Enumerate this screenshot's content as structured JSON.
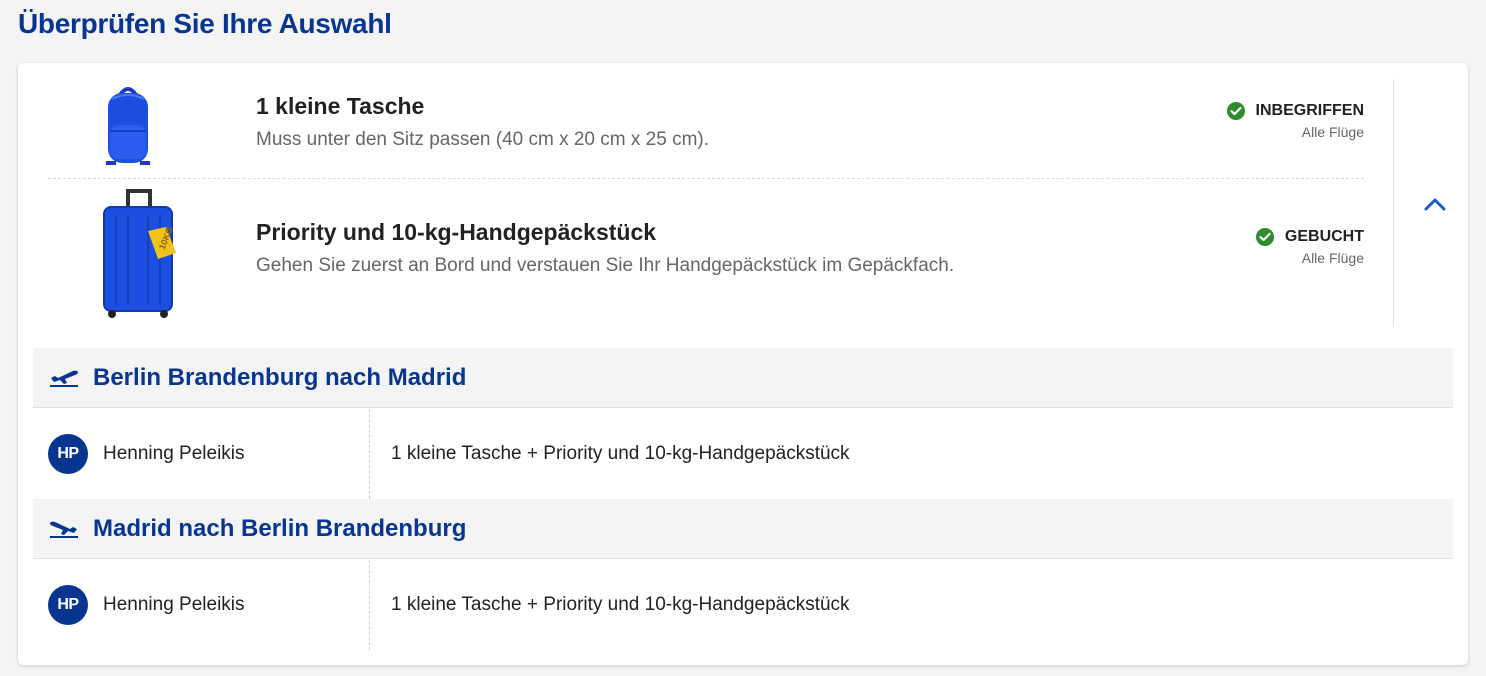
{
  "page_title": "Überprüfen Sie Ihre Auswahl",
  "bags": [
    {
      "icon": "backpack-icon",
      "title": "1 kleine Tasche",
      "description": "Muss unter den Sitz passen (40 cm x 20 cm x 25 cm).",
      "status": "INBEGRIFFEN",
      "status_sub": "Alle Flüge"
    },
    {
      "icon": "suitcase-icon",
      "tag_label": "10KG",
      "title": "Priority und 10-kg-Handgepäckstück",
      "description": "Gehen Sie zuerst an Bord und verstauen Sie Ihr Handgepäckstück im Gepäckfach.",
      "status": "GEBUCHT",
      "status_sub": "Alle Flüge"
    }
  ],
  "colors": {
    "brand_blue": "#073590",
    "accent_blue": "#1e5ac8",
    "success_green": "#2e8b2e",
    "bag_blue": "#1c4fe0"
  },
  "flights": [
    {
      "icon": "plane-departure-icon",
      "title": "Berlin Brandenburg nach Madrid",
      "passenger": {
        "initials": "HP",
        "name": "Henning Peleikis",
        "items": "1 kleine Tasche + Priority und 10-kg-Handgepäckstück"
      }
    },
    {
      "icon": "plane-return-icon",
      "title": "Madrid nach Berlin Brandenburg",
      "passenger": {
        "initials": "HP",
        "name": "Henning Peleikis",
        "items": "1 kleine Tasche + Priority und 10-kg-Handgepäckstück"
      }
    }
  ]
}
